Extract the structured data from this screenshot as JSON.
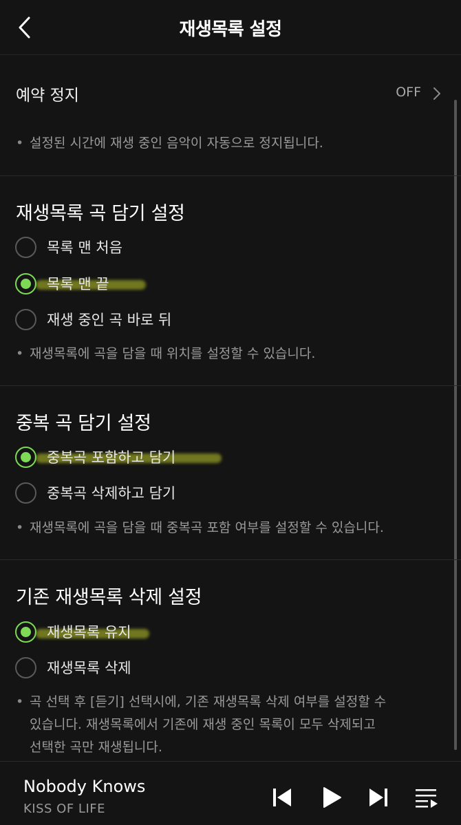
{
  "header": {
    "title": "재생목록 설정"
  },
  "reserve_stop": {
    "label": "예약 정지",
    "value": "OFF",
    "note": "설정된 시간에 재생 중인 음악이 자동으로 정지됩니다."
  },
  "add_position": {
    "title": "재생목록 곡 담기 설정",
    "options": [
      {
        "label": "목록 맨 처음",
        "selected": false
      },
      {
        "label": "목록 맨 끝",
        "selected": true
      },
      {
        "label": "재생 중인 곡 바로 뒤",
        "selected": false
      }
    ],
    "note": "재생목록에 곡을 담을 때 위치를 설정할 수 있습니다."
  },
  "duplicate": {
    "title": "중복 곡 담기 설정",
    "options": [
      {
        "label": "중복곡 포함하고 담기",
        "selected": true
      },
      {
        "label": "중복곡 삭제하고 담기",
        "selected": false
      }
    ],
    "note": "재생목록에 곡을 담을 때 중복곡 포함 여부를 설정할 수 있습니다."
  },
  "delete_existing": {
    "title": "기존 재생목록 삭제 설정",
    "options": [
      {
        "label": "재생목록 유지",
        "selected": true
      },
      {
        "label": "재생목록 삭제",
        "selected": false
      }
    ],
    "note_lines": [
      "곡 선택 후 [듣기] 선택시에, 기존 재생목록 삭제 여부를 설정할 수",
      "있습니다. 재생목록에서 기존에 재생 중인 목록이 모두 삭제되고",
      "선택한 곡만 재생됩니다."
    ]
  },
  "player": {
    "title": "Nobody Knows",
    "artist": "KISS OF LIFE",
    "icons": [
      "previous-icon",
      "play-icon",
      "next-icon",
      "playlist-icon"
    ]
  },
  "colors": {
    "accent": "#7ed957",
    "background": "#141414",
    "highlight": "#bec828"
  }
}
